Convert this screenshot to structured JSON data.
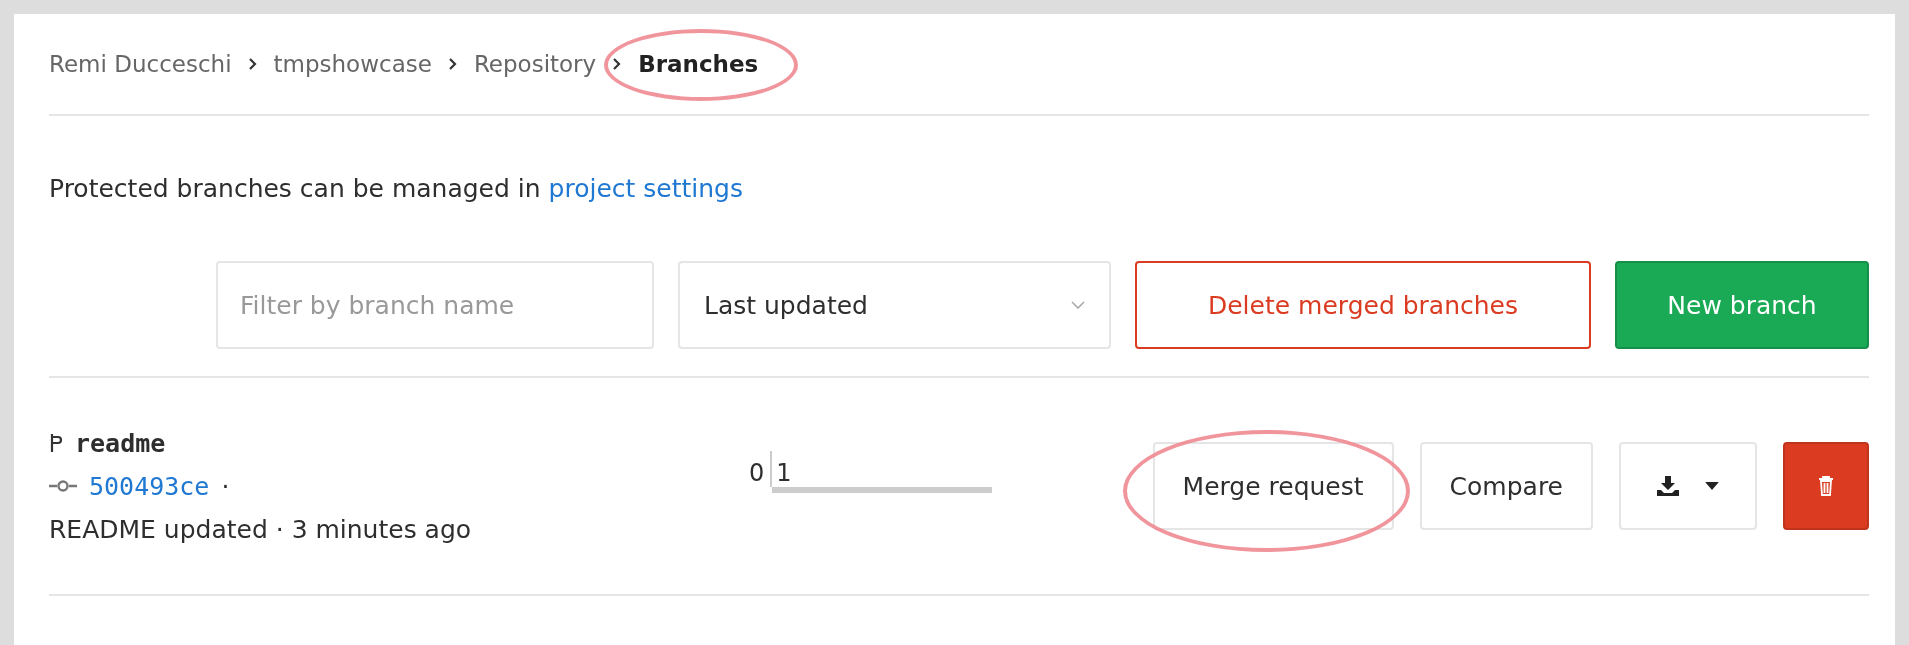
{
  "breadcrumbs": [
    {
      "label": "Remi Ducceschi",
      "current": false,
      "highlighted": false
    },
    {
      "label": "tmpshowcase",
      "current": false,
      "highlighted": false
    },
    {
      "label": "Repository",
      "current": false,
      "highlighted": false
    },
    {
      "label": "Branches",
      "current": true,
      "highlighted": true
    }
  ],
  "notice": {
    "text": "Protected branches can be managed in ",
    "link": "project settings"
  },
  "toolbar": {
    "filter": {
      "placeholder": "Filter by branch name"
    },
    "sort": {
      "value": "Last updated"
    },
    "delete_merged": "Delete merged branches",
    "new_branch": "New branch"
  },
  "branches": [
    {
      "name": "readme",
      "commit": "500493ce",
      "separator": "·",
      "message": "README updated · 3 minutes ago",
      "behind": {
        "count": "0"
      },
      "ahead": {
        "count": "1"
      },
      "actions": [
        {
          "kind": "merge",
          "label": "Merge request",
          "highlighted": true
        },
        {
          "kind": "compare",
          "label": "Compare",
          "highlighted": false
        },
        {
          "kind": "download",
          "highlighted": false
        },
        {
          "kind": "delete",
          "highlighted": false
        }
      ]
    }
  ]
}
